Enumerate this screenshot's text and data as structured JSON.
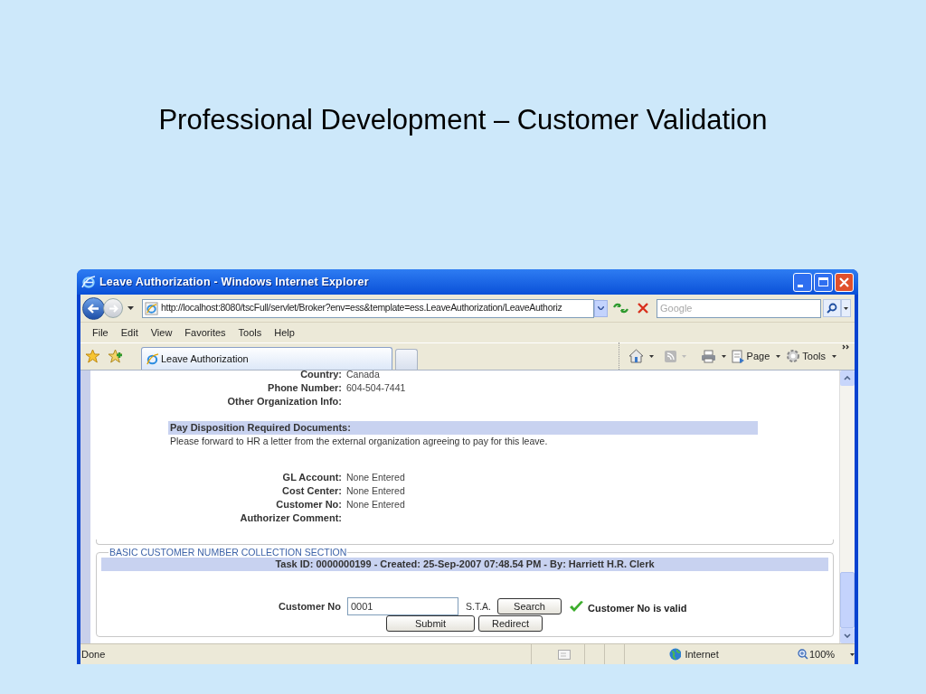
{
  "slide": {
    "title": "Professional Development – Customer Validation"
  },
  "window": {
    "title": "Leave Authorization - Windows Internet Explorer"
  },
  "address_bar": {
    "url": "http://localhost:8080/tscFull/servlet/Broker?env=ess&template=ess.LeaveAuthorization/LeaveAuthoriz"
  },
  "search": {
    "placeholder": "Google"
  },
  "menu": [
    "File",
    "Edit",
    "View",
    "Favorites",
    "Tools",
    "Help"
  ],
  "tabs": [
    {
      "label": "Leave Authorization",
      "selected": true
    }
  ],
  "command_bar": [
    "Page",
    "Tools"
  ],
  "org_fields": [
    {
      "label": "Country:",
      "value": "Canada"
    },
    {
      "label": "Phone Number:",
      "value": "604-504-7441"
    },
    {
      "label": "Other Organization Info:"
    }
  ],
  "pay_disposition": {
    "heading": "Pay Disposition Required Documents:",
    "text": "Please forward to HR a letter from the external organization agreeing to pay for this leave."
  },
  "account_fields": [
    {
      "label": "GL Account:",
      "value": "None Entered"
    },
    {
      "label": "Cost Center:",
      "value": "None Entered"
    },
    {
      "label": "Customer No:",
      "value": "None Entered"
    },
    {
      "label": "Authorizer Comment:"
    }
  ],
  "section": {
    "legend": "BASIC CUSTOMER NUMBER COLLECTION SECTION",
    "task_info": "Task ID: 0000000199 - Created: 25-Sep-2007 07:48.54 PM - By: Harriett H.R. Clerk",
    "customer_no": {
      "label": "Customer No",
      "value": "0001"
    },
    "sta": "S.T.A.",
    "search_button": "Search",
    "validation": {
      "valid": true,
      "message": "Customer No is valid"
    },
    "buttons": [
      "Submit",
      "Redirect"
    ]
  },
  "status_bar": {
    "text": "Done",
    "zone": "Internet",
    "zoom": "100%"
  }
}
